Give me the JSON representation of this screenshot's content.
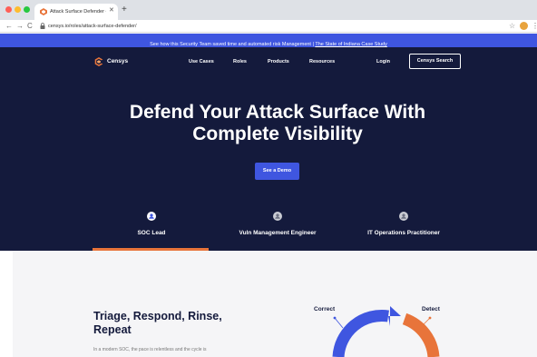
{
  "browser": {
    "tab_title": "Attack Surface Defender • Cen",
    "tab_close": "✕",
    "new_tab": "+",
    "url": "censys.io/roles/attack-surface-defender/",
    "nav_back": "←",
    "nav_forward": "→",
    "nav_reload": "C",
    "bookmark": "☆",
    "menu": "⋮"
  },
  "announcement": {
    "text": "See how this Security Team saved time and automated risk Management | ",
    "link": "The State of Indiana Case Study"
  },
  "header": {
    "logo_text": "Censys",
    "nav": [
      "Use Cases",
      "Roles",
      "Products",
      "Resources"
    ],
    "login": "Login",
    "search_button": "Censys Search"
  },
  "hero": {
    "title_line1": "Defend Your Attack Surface With",
    "title_line2": "Complete Visibility",
    "cta": "See a Demo"
  },
  "roles": [
    {
      "label": "SOC Lead",
      "active": true
    },
    {
      "label": "Vuln Management Engineer",
      "active": false
    },
    {
      "label": "IT Operations Practitioner",
      "active": false
    }
  ],
  "section": {
    "title": "Triage, Respond, Rinse, Repeat",
    "body": "In a modern SOC, the pace is relentless and the cycle is"
  },
  "cycle": {
    "correct": "Correct",
    "detect": "Detect"
  },
  "colors": {
    "brand_blue": "#3f56e0",
    "navy": "#141a3c",
    "accent_orange": "#e8743a"
  },
  "icons": {
    "favicon": "censys-logo-icon",
    "lock": "lock-icon",
    "extension": "extension-icon",
    "role": "role-avatar-icon"
  }
}
